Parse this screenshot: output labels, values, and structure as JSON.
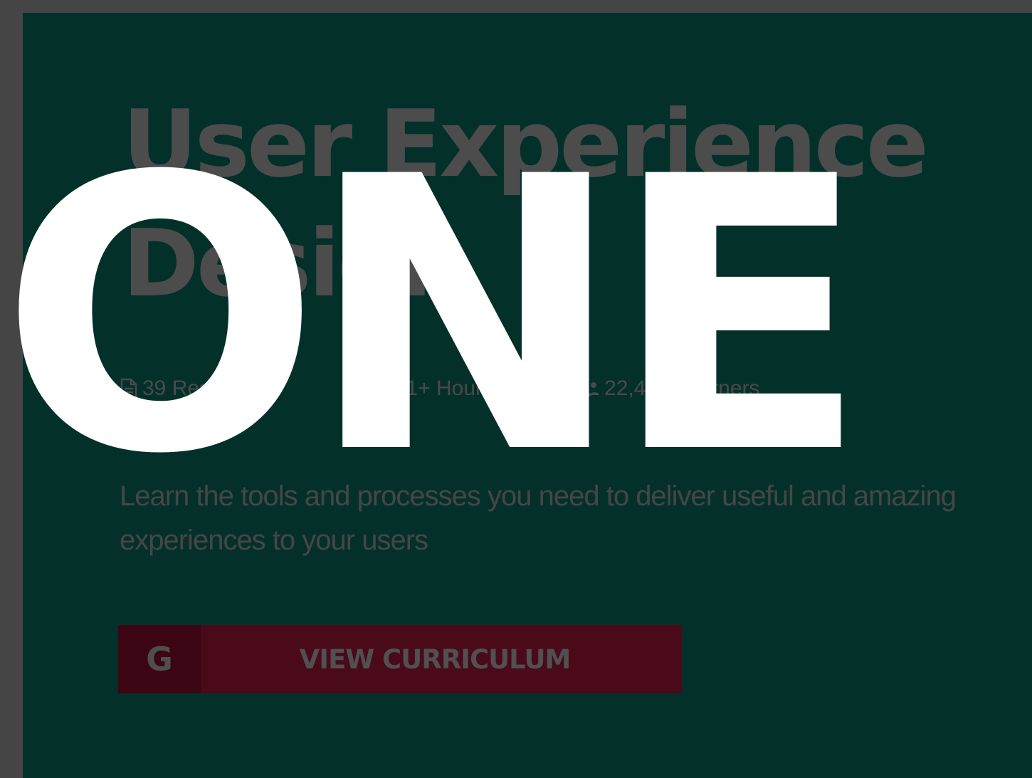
{
  "course": {
    "title": "User Experience Design",
    "stats": [
      {
        "icon": "document-icon",
        "text": "39 Resources"
      },
      {
        "icon": "clock-icon",
        "text": "131+ Hours"
      },
      {
        "icon": "learners-icon",
        "text": "22,482 Learners"
      }
    ],
    "description": "Learn the tools and processes you need to deliver useful and amazing experiences to your users",
    "cta": {
      "badge": "G",
      "label": "VIEW CURRICULUM"
    }
  },
  "overlay": {
    "text": "ONE",
    "color": "#ffffff"
  },
  "colors": {
    "page_background": "#454545",
    "card_background": "#04302a",
    "button": "#4a0a19",
    "button_badge": "#3b0513"
  }
}
